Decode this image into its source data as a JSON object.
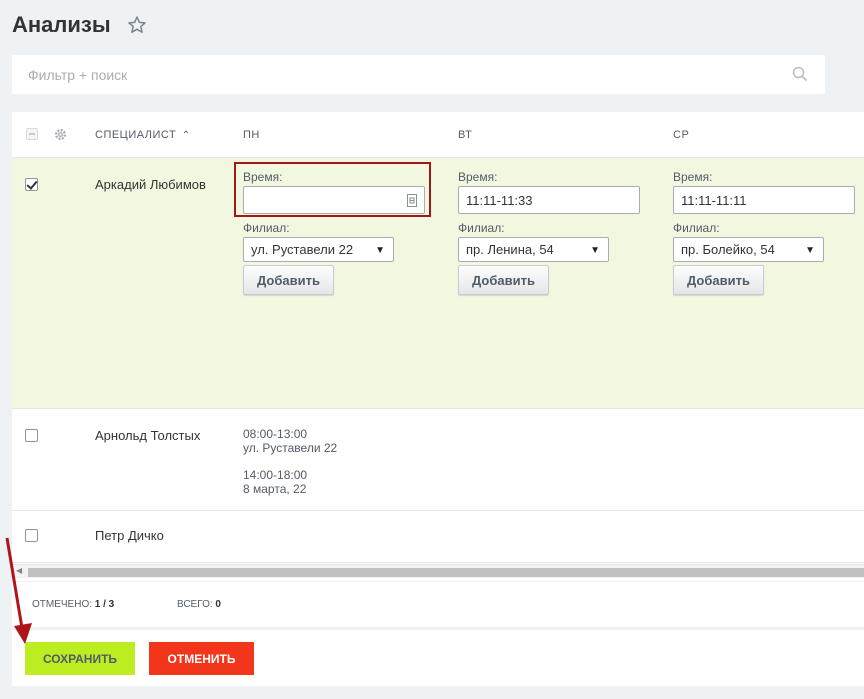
{
  "page": {
    "title": "Анализы"
  },
  "filter": {
    "placeholder": "Фильтр + поиск"
  },
  "grid": {
    "columns": {
      "specialist": "СПЕЦИАЛИСТ",
      "mon": "ПН",
      "tue": "ВТ",
      "wed": "СР"
    },
    "sort_indicator": "⌃",
    "field_labels": {
      "time": "Время:",
      "branch": "Филиал:",
      "add": "Добавить"
    },
    "rows": [
      {
        "name": "Аркадий Любимов",
        "checked": true,
        "mon": {
          "time": "",
          "branch": "ул. Руставели 22"
        },
        "tue": {
          "time": "11:11-11:33",
          "branch": "пр. Ленина, 54"
        },
        "wed": {
          "time": "11:11-11:11",
          "branch": "пр. Болейко, 54"
        }
      },
      {
        "name": "Арнольд Толстых",
        "checked": false,
        "mon_slots": [
          {
            "time": "08:00-13:00",
            "place": "ул. Руставели 22"
          },
          {
            "time": "14:00-18:00",
            "place": "8 марта, 22"
          }
        ]
      },
      {
        "name": "Петр Дичко",
        "checked": false
      }
    ]
  },
  "footer": {
    "selected_label": "ОТМЕЧЕНО:",
    "selected_value": "1 / 3",
    "total_label": "ВСЕГО:",
    "total_value": "0"
  },
  "actions": {
    "save": "СОХРАНИТЬ",
    "cancel": "ОТМЕНИТЬ"
  },
  "colors": {
    "selected_row": "#f2f8e0",
    "save": "#bbed21",
    "cancel": "#f1361b",
    "highlight": "#a01818",
    "arrow": "#b0141b"
  }
}
